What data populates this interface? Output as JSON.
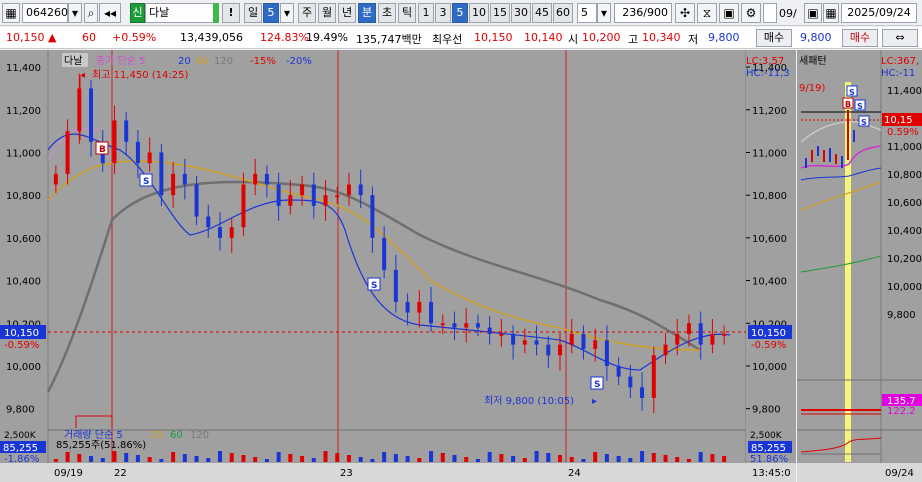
{
  "toolbar": {
    "code": "064260",
    "badge": "신",
    "name": "다날",
    "excl": "!",
    "day": "일",
    "five": "5",
    "week": "주",
    "month": "월",
    "year": "년",
    "minute": "분",
    "second": "초",
    "tick": "틱",
    "intervals": [
      "1",
      "3",
      "5",
      "10",
      "15",
      "30",
      "45",
      "60"
    ],
    "interval_select": "5",
    "bars_count": "236/900",
    "date_clip": "09/",
    "date": "2025/09/24"
  },
  "quote": {
    "price": "10,150 ▲",
    "change": "60",
    "change_pct": "+0.59%",
    "volume": "13,439,056",
    "vol_ratio": "124.83%",
    "turnover": "19.49%",
    "amount": "135,747백만",
    "best_ask_label": "최우선",
    "ask": "10,150",
    "bid": "10,140",
    "open_label": "시",
    "open": "10,200",
    "high_label": "고",
    "high": "10,340",
    "low_label": "저",
    "low": "9,800",
    "buy_button": "매수",
    "right_price": "9,800",
    "right_buy_button": "매수"
  },
  "chart": {
    "legend_name": "다날",
    "legend_ma": "종가 단순 5",
    "legend_ma_periods": [
      "20",
      "60",
      "120"
    ],
    "legend_env": [
      "-15%",
      "-20%"
    ],
    "high_note": "최고 11,450 (14:25)",
    "low_note": "최저 9,800 (10:05)",
    "lc": "LC:3,57",
    "hc": "HC:-11,3",
    "price_axis": [
      "11,400",
      "11,200",
      "11,000",
      "10,800",
      "10,600",
      "10,400",
      "10,200",
      "10,000",
      "9,800"
    ],
    "current_price": "10,150",
    "current_pct": "-0.59%",
    "vol_legend": "거래량 단순 5",
    "vol_legend_periods": [
      "20",
      "60",
      "120"
    ],
    "vol_value": "85,255주(51.86%)",
    "vol_axis_top": "2,500K",
    "vol_current": "85,255",
    "vol_pct": "-1.86%",
    "vol_pct_right": "51.86%",
    "date_axis": [
      "09/19",
      "22",
      "23",
      "24"
    ],
    "time_label": "13:45:0",
    "signals": [
      "B",
      "S",
      "S",
      "S"
    ]
  },
  "chart_data": {
    "type": "candlestick",
    "title": "",
    "y_range": [
      9700,
      11480
    ],
    "reference_price": 10150,
    "series": [
      {
        "name": "다날",
        "values": [
          10900,
          11100,
          11300,
          11050,
          10950,
          11150,
          11050,
          10950,
          11000,
          10800,
          10900,
          10850,
          10700,
          10650,
          10600,
          10650,
          10850,
          10900,
          10850,
          10750,
          10800,
          10850,
          10750,
          10800,
          10800,
          10850,
          10800,
          10600,
          10450,
          10300,
          10250,
          10300,
          10200,
          10200,
          10180,
          10200,
          10180,
          10150,
          10150,
          10100,
          10120,
          10100,
          10050,
          10100,
          10150,
          10080,
          10120,
          10000,
          9950,
          9900,
          9850,
          10050,
          10100,
          10150,
          10200,
          10100,
          10150,
          10150
        ]
      }
    ]
  },
  "mini": {
    "title": "세패턴",
    "lc": "LC:367,",
    "hc": "HC:-11",
    "date_label": "9/19)",
    "price_axis": [
      "11,400",
      "11,200",
      "11,000",
      "10,800",
      "10,600",
      "10,400",
      "10,200",
      "10,000",
      "9,800"
    ],
    "current": "10,15",
    "current_pct": "0.59%",
    "osc_val1": "135.7",
    "osc_val2": "122.2",
    "date_axis": "09/24",
    "signals": [
      "S",
      "B",
      "S",
      "S"
    ]
  },
  "colors": {
    "up": "#e00000",
    "down": "#1a35d6",
    "background": "#a0a0a0",
    "ma120": "#6f6f6f",
    "ma60": "#d2a020",
    "ma20": "#1a35d6",
    "highlight": "#f5f57a"
  }
}
